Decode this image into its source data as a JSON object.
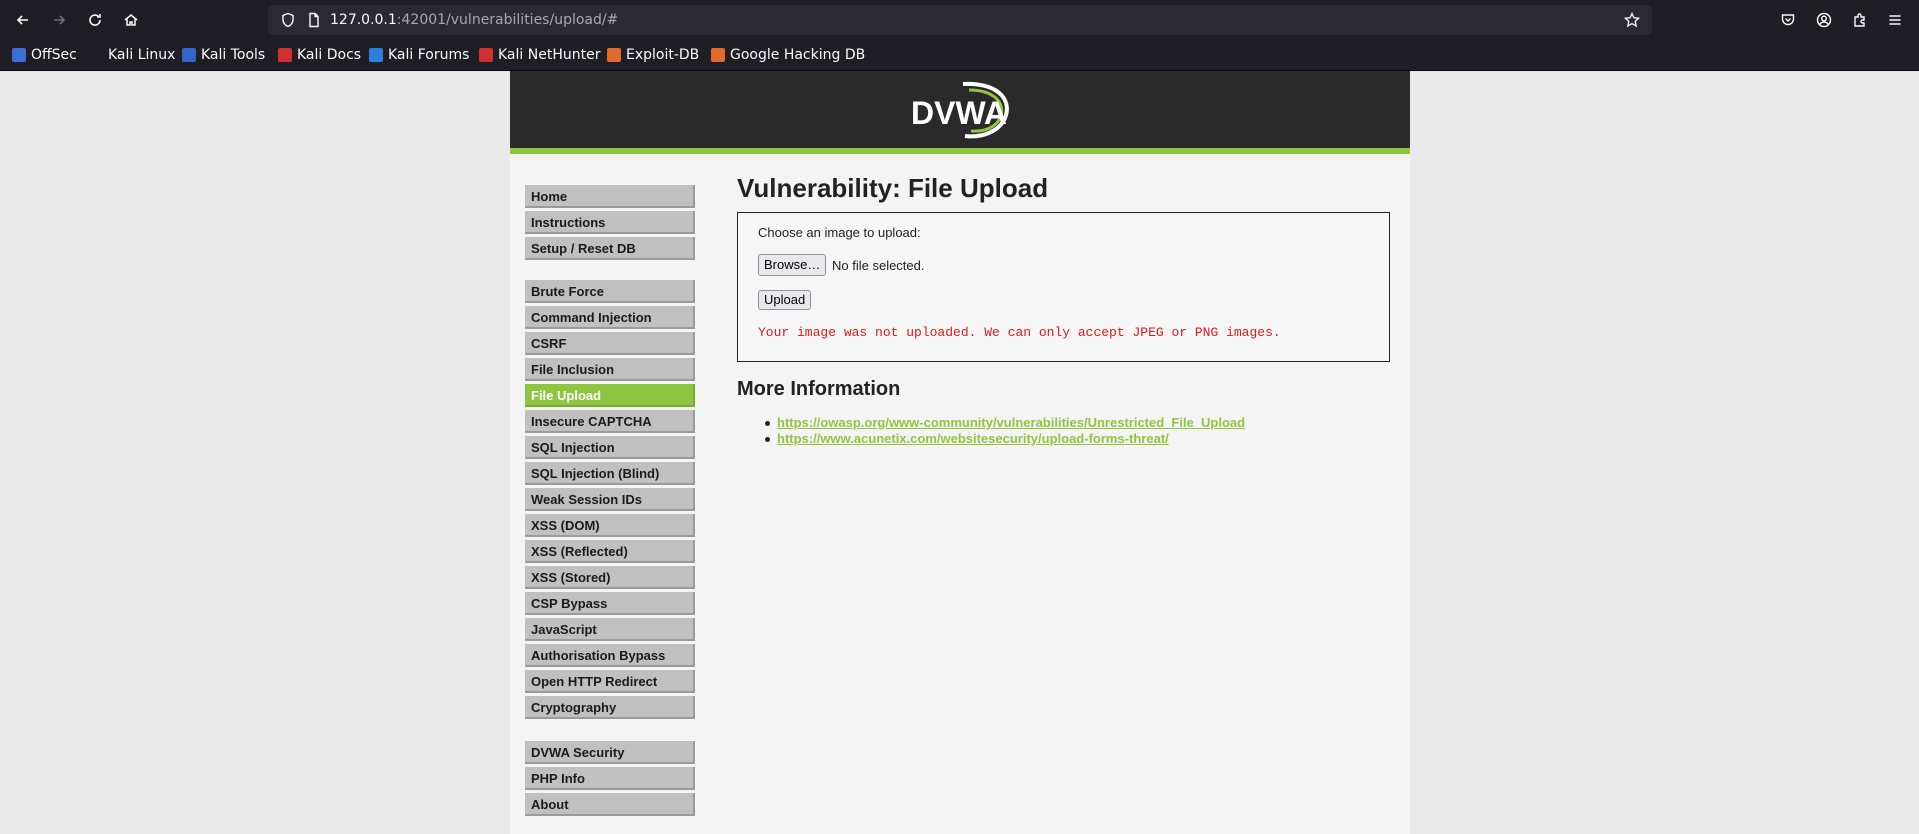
{
  "browser": {
    "url_host": "127.0.0.1",
    "url_rest": ":42001/vulnerabilities/upload/#",
    "bookmarks": [
      {
        "label": "OffSec",
        "color": "#3c6fd6"
      },
      {
        "label": "Kali Linux",
        "color": "#1f1e25"
      },
      {
        "label": "Kali Tools",
        "color": "#3565c9"
      },
      {
        "label": "Kali Docs",
        "color": "#d32f2f"
      },
      {
        "label": "Kali Forums",
        "color": "#2f7fe0"
      },
      {
        "label": "Kali NetHunter",
        "color": "#d32f2f"
      },
      {
        "label": "Exploit-DB",
        "color": "#e06a2c"
      },
      {
        "label": "Google Hacking DB",
        "color": "#e06a2c"
      }
    ]
  },
  "logo": {
    "text": "DVWA",
    "accent": "#8fc63f"
  },
  "menu": {
    "group1": [
      "Home",
      "Instructions",
      "Setup / Reset DB"
    ],
    "group2": [
      "Brute Force",
      "Command Injection",
      "CSRF",
      "File Inclusion",
      "File Upload",
      "Insecure CAPTCHA",
      "SQL Injection",
      "SQL Injection (Blind)",
      "Weak Session IDs",
      "XSS (DOM)",
      "XSS (Reflected)",
      "XSS (Stored)",
      "CSP Bypass",
      "JavaScript",
      "Authorisation Bypass",
      "Open HTTP Redirect",
      "Cryptography"
    ],
    "group3": [
      "DVWA Security",
      "PHP Info",
      "About"
    ],
    "active": "File Upload"
  },
  "main": {
    "title": "Vulnerability: File Upload",
    "prompt": "Choose an image to upload:",
    "browse_label": "Browse…",
    "no_file": "No file selected.",
    "upload_label": "Upload",
    "error": "Your image was not uploaded. We can only accept JPEG or PNG images.",
    "more_title": "More Information",
    "links": [
      "https://owasp.org/www-community/vulnerabilities/Unrestricted_File_Upload",
      "https://www.acunetix.com/websitesecurity/upload-forms-threat/"
    ]
  }
}
